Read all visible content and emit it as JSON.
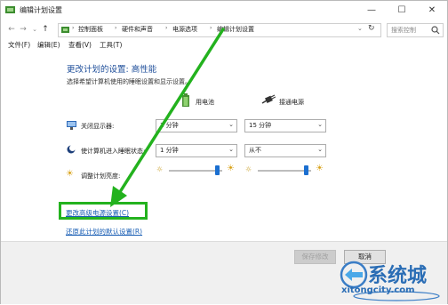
{
  "window": {
    "title": "编辑计划设置",
    "minimize": "—",
    "maximize": "☐",
    "close": "✕"
  },
  "nav": {
    "back": "←",
    "forward": "→",
    "dropdown": "⌄",
    "up": "↑"
  },
  "address": {
    "crumbs": [
      "控制面板",
      "硬件和声音",
      "电源选项",
      "编辑计划设置"
    ],
    "refresh": "↻",
    "search_placeholder": "搜索控制"
  },
  "menu": {
    "file": "文件(F)",
    "edit": "编辑(E)",
    "view": "查看(V)",
    "tools": "工具(T)"
  },
  "content": {
    "title": "更改计划的设置: 高性能",
    "description": "选择希望计算机使用的睡眠设置和显示设置。",
    "col_battery": "用电池",
    "col_plugged": "接通电源",
    "rows": [
      {
        "label": "关闭显示器:",
        "battery": "1 分钟",
        "plugged": "15 分钟"
      },
      {
        "label": "使计算机进入睡眠状态:",
        "battery": "1 分钟",
        "plugged": "从不"
      },
      {
        "label": "调整计划亮度:",
        "battery_level": 0.9,
        "plugged_level": 0.9
      }
    ],
    "link_advanced": "更改高级电源设置(C)",
    "link_restore": "还原此计划的默认设置(R)"
  },
  "footer": {
    "save": "保存修改",
    "cancel": "取消"
  },
  "watermark": {
    "brand_cn": "系统城",
    "brand_url": "xitongcity.com"
  },
  "colors": {
    "arrow": "#23b21e",
    "link": "#1b5fb5",
    "title": "#1e4e9a",
    "slider": "#1b6fd0"
  }
}
